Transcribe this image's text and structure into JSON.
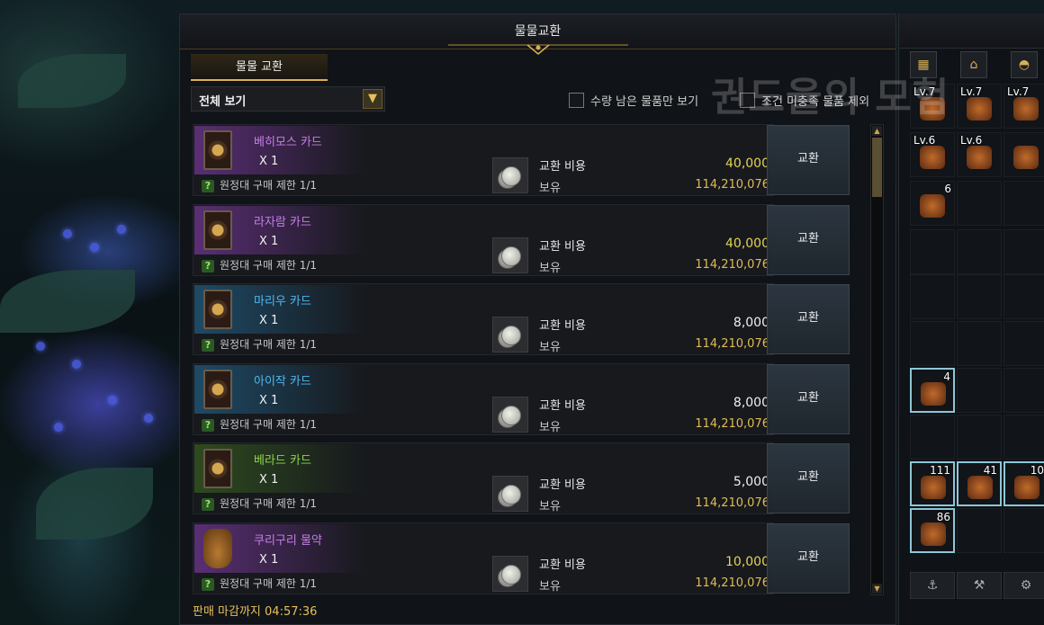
{
  "window": {
    "title": "물물교환"
  },
  "tab": {
    "label": "물물 교환"
  },
  "filter": {
    "selected": "전체 보기",
    "dropdown_icon": "chevron-down-icon"
  },
  "checkboxes": [
    {
      "label": "수량 남은 물품만 보기",
      "checked": false
    },
    {
      "label": "조건 미충족 물품 제외",
      "checked": false
    }
  ],
  "labels": {
    "cost": "교환 비용",
    "held": "보유",
    "exchange_button": "교환"
  },
  "items": [
    {
      "name": "베히모스 카드",
      "qty": "X 1",
      "limit": "원정대 구매 제한 1/1",
      "cost": "40,000",
      "held": "114,210,076",
      "name_color": "#c77ee8",
      "cost_color": "#e6d35a",
      "bg_color": "#5a2e74",
      "icon": "card-icon"
    },
    {
      "name": "라자람 카드",
      "qty": "X 1",
      "limit": "원정대 구매 제한 1/1",
      "cost": "40,000",
      "held": "114,210,076",
      "name_color": "#c77ee8",
      "cost_color": "#e6d35a",
      "bg_color": "#5a2e74",
      "icon": "card-icon"
    },
    {
      "name": "마리우 카드",
      "qty": "X 1",
      "limit": "원정대 구매 제한 1/1",
      "cost": "8,000",
      "held": "114,210,076",
      "name_color": "#4eb8ee",
      "cost_color": "#f0f0f0",
      "bg_color": "#1e4a66",
      "icon": "card-icon"
    },
    {
      "name": "아이작 카드",
      "qty": "X 1",
      "limit": "원정대 구매 제한 1/1",
      "cost": "8,000",
      "held": "114,210,076",
      "name_color": "#4eb8ee",
      "cost_color": "#f0f0f0",
      "bg_color": "#1e4a66",
      "icon": "card-icon"
    },
    {
      "name": "베라드 카드",
      "qty": "X 1",
      "limit": "원정대 구매 제한 1/1",
      "cost": "5,000",
      "held": "114,210,076",
      "name_color": "#8cd64a",
      "cost_color": "#f0f0f0",
      "bg_color": "#2e4a1e",
      "icon": "card-icon"
    },
    {
      "name": "쿠리구리 물약",
      "qty": "X 1",
      "limit": "원정대 구매 제한 1/1",
      "cost": "10,000",
      "held": "114,210,076",
      "name_color": "#c77ee8",
      "cost_color": "#e6d35a",
      "bg_color": "#5a2e74",
      "icon": "potion-jar-icon"
    }
  ],
  "footer": {
    "deadline": "판매 마감까지 04:57:36"
  },
  "inventory": {
    "tabs": [
      "grid-icon",
      "bag-icon",
      "helmet-icon"
    ],
    "slots": [
      {
        "lv": "Lv.7"
      },
      {
        "lv": "Lv.7"
      },
      {
        "lv": "Lv.7"
      },
      {
        "lv": "Lv.6"
      },
      {
        "lv": "Lv.6"
      },
      {
        "lv": ""
      },
      {
        "count": "6"
      },
      {
        "count": "4"
      },
      {
        "count": "111"
      },
      {
        "count": "41"
      },
      {
        "count": "10"
      },
      {
        "count": "86"
      }
    ]
  },
  "watermark": "권도율의 모험"
}
